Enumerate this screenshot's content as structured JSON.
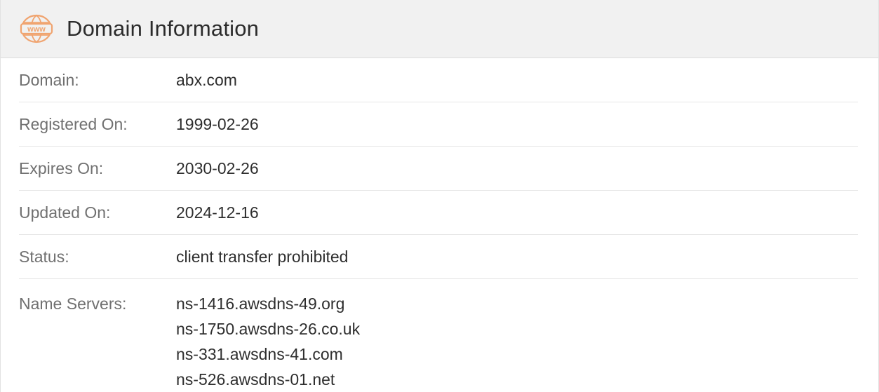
{
  "header": {
    "title": "Domain Information",
    "icon": "www-globe-icon",
    "icon_text": "www",
    "icon_color": "#f0a470"
  },
  "rows": [
    {
      "label": "Domain:",
      "value": "abx.com"
    },
    {
      "label": "Registered On:",
      "value": "1999-02-26"
    },
    {
      "label": "Expires On:",
      "value": "2030-02-26"
    },
    {
      "label": "Updated On:",
      "value": "2024-12-16"
    },
    {
      "label": "Status:",
      "value": "client transfer prohibited"
    }
  ],
  "name_servers": {
    "label": "Name Servers:",
    "values": [
      "ns-1416.awsdns-49.org",
      "ns-1750.awsdns-26.co.uk",
      "ns-331.awsdns-41.com",
      "ns-526.awsdns-01.net"
    ]
  }
}
